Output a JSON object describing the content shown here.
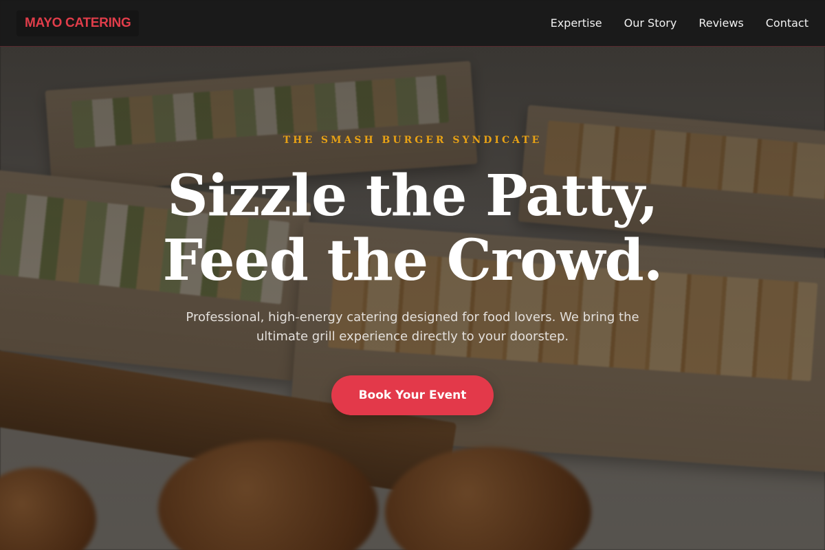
{
  "nav": {
    "brand": "MAYO CATERING",
    "links": [
      "Expertise",
      "Our Story",
      "Reviews",
      "Contact"
    ]
  },
  "hero": {
    "eyebrow": "THE SMASH BURGER SYNDICATE",
    "headline_line1": "Sizzle the Patty,",
    "headline_line2": "Feed the Crowd.",
    "subtext": "Professional, high-energy catering designed for food lovers. We bring the ultimate grill experience directly to your doorstep.",
    "cta_label": "Book Your Event"
  },
  "colors": {
    "accent": "#e3394a",
    "eyebrow": "#e8a215",
    "nav_background": "#181818"
  }
}
